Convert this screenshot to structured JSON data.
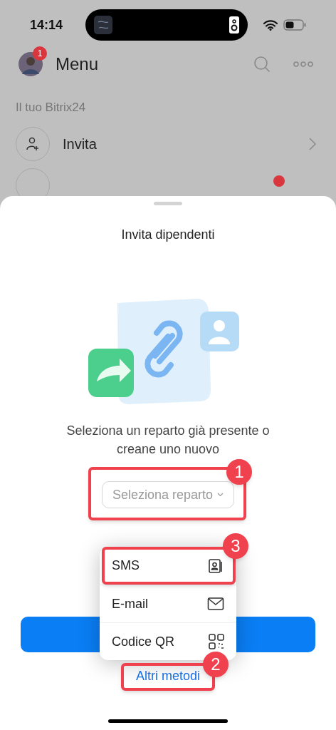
{
  "status_bar": {
    "time": "14:14"
  },
  "header": {
    "title": "Menu",
    "avatar_badge": "1"
  },
  "section": {
    "title": "Il tuo Bitrix24"
  },
  "menu_items": [
    {
      "label": "Invita"
    }
  ],
  "sheet": {
    "title": "Invita dipendenti",
    "description": "Seleziona un reparto già presente o creane uno nuovo",
    "select": {
      "placeholder": "Seleziona reparto"
    },
    "link": "Altri metodi"
  },
  "popup_menu": [
    {
      "label": "SMS",
      "kind": "contacts"
    },
    {
      "label": "E-mail",
      "kind": "mail"
    },
    {
      "label": "Codice QR",
      "kind": "qr"
    }
  ],
  "annotations": [
    {
      "number": "1",
      "kind": "select"
    },
    {
      "number": "3",
      "kind": "sms"
    },
    {
      "number": "2",
      "kind": "link"
    }
  ]
}
